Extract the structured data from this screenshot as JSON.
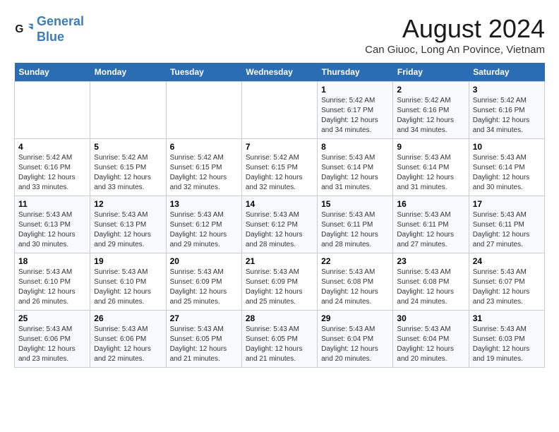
{
  "logo": {
    "line1": "General",
    "line2": "Blue"
  },
  "title": "August 2024",
  "subtitle": "Can Giuoc, Long An Povince, Vietnam",
  "weekdays": [
    "Sunday",
    "Monday",
    "Tuesday",
    "Wednesday",
    "Thursday",
    "Friday",
    "Saturday"
  ],
  "weeks": [
    [
      {
        "day": "",
        "info": ""
      },
      {
        "day": "",
        "info": ""
      },
      {
        "day": "",
        "info": ""
      },
      {
        "day": "",
        "info": ""
      },
      {
        "day": "1",
        "info": "Sunrise: 5:42 AM\nSunset: 6:17 PM\nDaylight: 12 hours\nand 34 minutes."
      },
      {
        "day": "2",
        "info": "Sunrise: 5:42 AM\nSunset: 6:16 PM\nDaylight: 12 hours\nand 34 minutes."
      },
      {
        "day": "3",
        "info": "Sunrise: 5:42 AM\nSunset: 6:16 PM\nDaylight: 12 hours\nand 34 minutes."
      }
    ],
    [
      {
        "day": "4",
        "info": "Sunrise: 5:42 AM\nSunset: 6:16 PM\nDaylight: 12 hours\nand 33 minutes."
      },
      {
        "day": "5",
        "info": "Sunrise: 5:42 AM\nSunset: 6:15 PM\nDaylight: 12 hours\nand 33 minutes."
      },
      {
        "day": "6",
        "info": "Sunrise: 5:42 AM\nSunset: 6:15 PM\nDaylight: 12 hours\nand 32 minutes."
      },
      {
        "day": "7",
        "info": "Sunrise: 5:42 AM\nSunset: 6:15 PM\nDaylight: 12 hours\nand 32 minutes."
      },
      {
        "day": "8",
        "info": "Sunrise: 5:43 AM\nSunset: 6:14 PM\nDaylight: 12 hours\nand 31 minutes."
      },
      {
        "day": "9",
        "info": "Sunrise: 5:43 AM\nSunset: 6:14 PM\nDaylight: 12 hours\nand 31 minutes."
      },
      {
        "day": "10",
        "info": "Sunrise: 5:43 AM\nSunset: 6:14 PM\nDaylight: 12 hours\nand 30 minutes."
      }
    ],
    [
      {
        "day": "11",
        "info": "Sunrise: 5:43 AM\nSunset: 6:13 PM\nDaylight: 12 hours\nand 30 minutes."
      },
      {
        "day": "12",
        "info": "Sunrise: 5:43 AM\nSunset: 6:13 PM\nDaylight: 12 hours\nand 29 minutes."
      },
      {
        "day": "13",
        "info": "Sunrise: 5:43 AM\nSunset: 6:12 PM\nDaylight: 12 hours\nand 29 minutes."
      },
      {
        "day": "14",
        "info": "Sunrise: 5:43 AM\nSunset: 6:12 PM\nDaylight: 12 hours\nand 28 minutes."
      },
      {
        "day": "15",
        "info": "Sunrise: 5:43 AM\nSunset: 6:11 PM\nDaylight: 12 hours\nand 28 minutes."
      },
      {
        "day": "16",
        "info": "Sunrise: 5:43 AM\nSunset: 6:11 PM\nDaylight: 12 hours\nand 27 minutes."
      },
      {
        "day": "17",
        "info": "Sunrise: 5:43 AM\nSunset: 6:11 PM\nDaylight: 12 hours\nand 27 minutes."
      }
    ],
    [
      {
        "day": "18",
        "info": "Sunrise: 5:43 AM\nSunset: 6:10 PM\nDaylight: 12 hours\nand 26 minutes."
      },
      {
        "day": "19",
        "info": "Sunrise: 5:43 AM\nSunset: 6:10 PM\nDaylight: 12 hours\nand 26 minutes."
      },
      {
        "day": "20",
        "info": "Sunrise: 5:43 AM\nSunset: 6:09 PM\nDaylight: 12 hours\nand 25 minutes."
      },
      {
        "day": "21",
        "info": "Sunrise: 5:43 AM\nSunset: 6:09 PM\nDaylight: 12 hours\nand 25 minutes."
      },
      {
        "day": "22",
        "info": "Sunrise: 5:43 AM\nSunset: 6:08 PM\nDaylight: 12 hours\nand 24 minutes."
      },
      {
        "day": "23",
        "info": "Sunrise: 5:43 AM\nSunset: 6:08 PM\nDaylight: 12 hours\nand 24 minutes."
      },
      {
        "day": "24",
        "info": "Sunrise: 5:43 AM\nSunset: 6:07 PM\nDaylight: 12 hours\nand 23 minutes."
      }
    ],
    [
      {
        "day": "25",
        "info": "Sunrise: 5:43 AM\nSunset: 6:06 PM\nDaylight: 12 hours\nand 23 minutes."
      },
      {
        "day": "26",
        "info": "Sunrise: 5:43 AM\nSunset: 6:06 PM\nDaylight: 12 hours\nand 22 minutes."
      },
      {
        "day": "27",
        "info": "Sunrise: 5:43 AM\nSunset: 6:05 PM\nDaylight: 12 hours\nand 21 minutes."
      },
      {
        "day": "28",
        "info": "Sunrise: 5:43 AM\nSunset: 6:05 PM\nDaylight: 12 hours\nand 21 minutes."
      },
      {
        "day": "29",
        "info": "Sunrise: 5:43 AM\nSunset: 6:04 PM\nDaylight: 12 hours\nand 20 minutes."
      },
      {
        "day": "30",
        "info": "Sunrise: 5:43 AM\nSunset: 6:04 PM\nDaylight: 12 hours\nand 20 minutes."
      },
      {
        "day": "31",
        "info": "Sunrise: 5:43 AM\nSunset: 6:03 PM\nDaylight: 12 hours\nand 19 minutes."
      }
    ]
  ]
}
